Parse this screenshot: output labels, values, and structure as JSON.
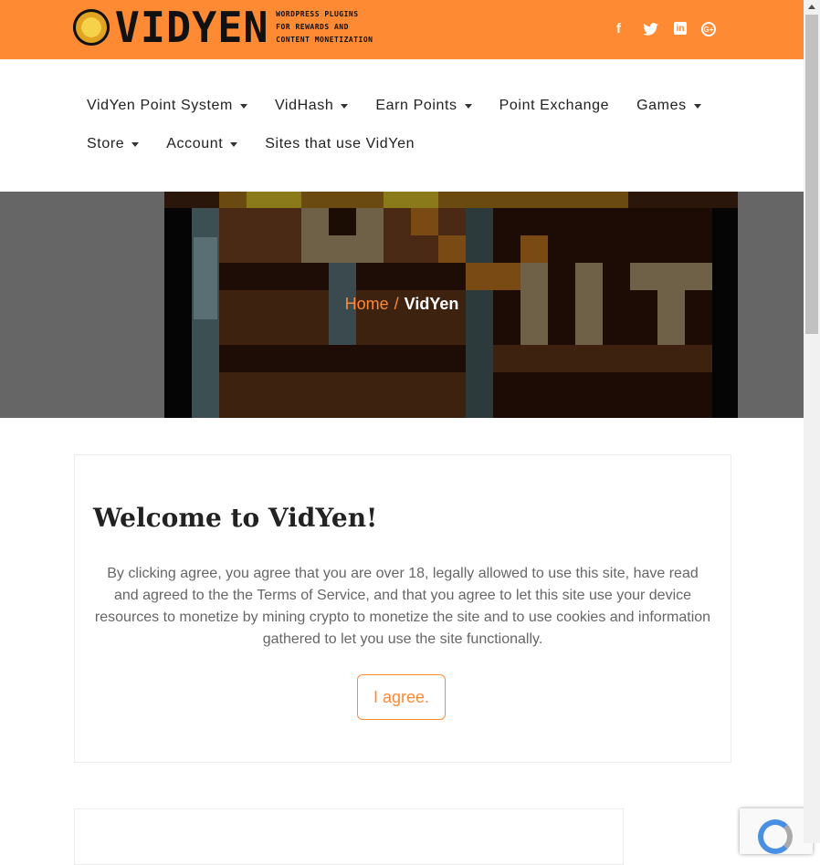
{
  "header": {
    "logo_text": "VIDYEN",
    "tagline": [
      "WORDPRESS PLUGINS",
      "FOR REWARDS AND",
      "CONTENT MONETIZATION"
    ],
    "social_icons": [
      "facebook-icon",
      "twitter-icon",
      "linkedin-icon",
      "google-plus-icon"
    ],
    "brand_color": "#fe8a33"
  },
  "nav": {
    "row1": [
      {
        "label": "VidYen Point System",
        "dropdown": true
      },
      {
        "label": "VidHash",
        "dropdown": true
      },
      {
        "label": "Earn Points",
        "dropdown": true
      },
      {
        "label": "Point Exchange",
        "dropdown": false
      },
      {
        "label": "Games",
        "dropdown": true
      }
    ],
    "row2": [
      {
        "label": "Store",
        "dropdown": true
      },
      {
        "label": "Account",
        "dropdown": true
      },
      {
        "label": "Sites that use VidYen",
        "dropdown": false
      }
    ]
  },
  "breadcrumb": {
    "home": "Home",
    "separator": "/",
    "current": "VidYen"
  },
  "welcome": {
    "title": "Welcome to VidYen!",
    "body": "By clicking agree, you agree that you are over 18, legally allowed to use this site, have read and agreed to the the Terms of Service, and that you agree to let this site use your device resources to monetize by mining crypto to monetize the site and to use cookies and information gathered to let you use the site functionally.",
    "agree_label": "I agree."
  }
}
